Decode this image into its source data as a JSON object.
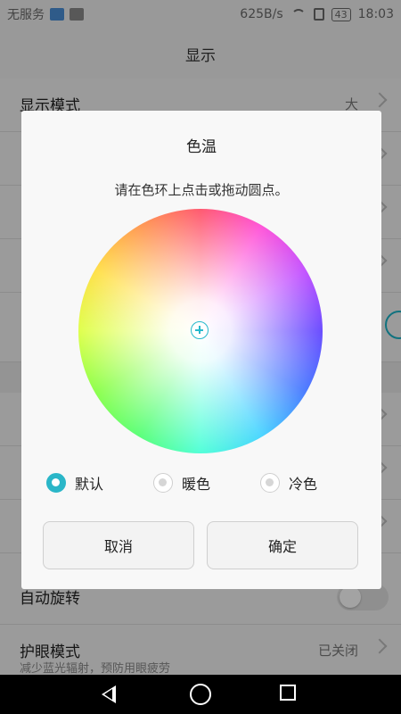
{
  "status_bar": {
    "carrier": "无服务",
    "net_speed": "625B/s",
    "battery": "43",
    "time": "18:03"
  },
  "app_bar": {
    "title": "显示"
  },
  "settings": {
    "display_mode": {
      "title": "显示模式",
      "value": "大"
    },
    "auto_rotate": {
      "title": "自动旋转"
    },
    "eye_comfort": {
      "title": "护眼模式",
      "subtitle": "减少蓝光辐射，预防用眼疲劳",
      "value": "已关闭"
    }
  },
  "dialog": {
    "title": "色温",
    "hint": "请在色环上点击或拖动圆点。",
    "options": [
      {
        "label": "默认",
        "selected": true
      },
      {
        "label": "暖色",
        "selected": false
      },
      {
        "label": "冷色",
        "selected": false
      }
    ],
    "cancel_label": "取消",
    "ok_label": "确定"
  },
  "colors": {
    "accent": "#2ab6c8"
  }
}
